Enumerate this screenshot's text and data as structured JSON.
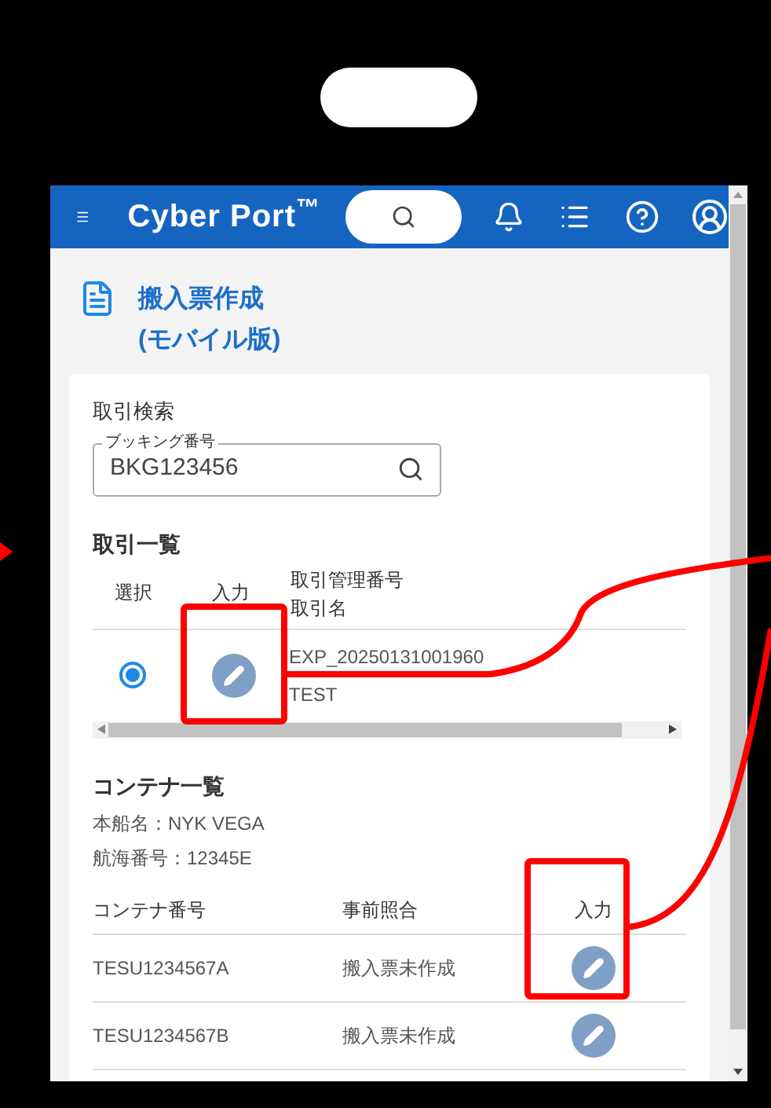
{
  "header": {
    "brand": "Cyber Port$^{™}$"
  },
  "page": {
    "title_lines": [
      "搬入票作成",
      "(モバイル版)"
    ]
  },
  "search": {
    "heading": "取引検索",
    "field": {
      "label": "ブッキング番号",
      "value": "BKG123456"
    }
  },
  "transactions": {
    "heading": "取引一覧",
    "columns": [
      "選択",
      "入力",
      [
        "取引管理番号",
        "取引名"
      ]
    ],
    "rows": [
      {
        "selected": true,
        "id": "EXP_20250131001960",
        "name": "TEST"
      }
    ]
  },
  "containers": {
    "heading": "コンテナ一覧",
    "info": [
      "本船名：NYK VEGA",
      "航海番号：12345E"
    ],
    "columns": [
      "コンテナ番号",
      "事前照合",
      "入力"
    ],
    "rows": [
      {
        "number": "TESU1234567A",
        "status": "搬入票未作成"
      },
      {
        "number": "TESU1234567B",
        "status": "搬入票未作成"
      }
    ]
  }
}
